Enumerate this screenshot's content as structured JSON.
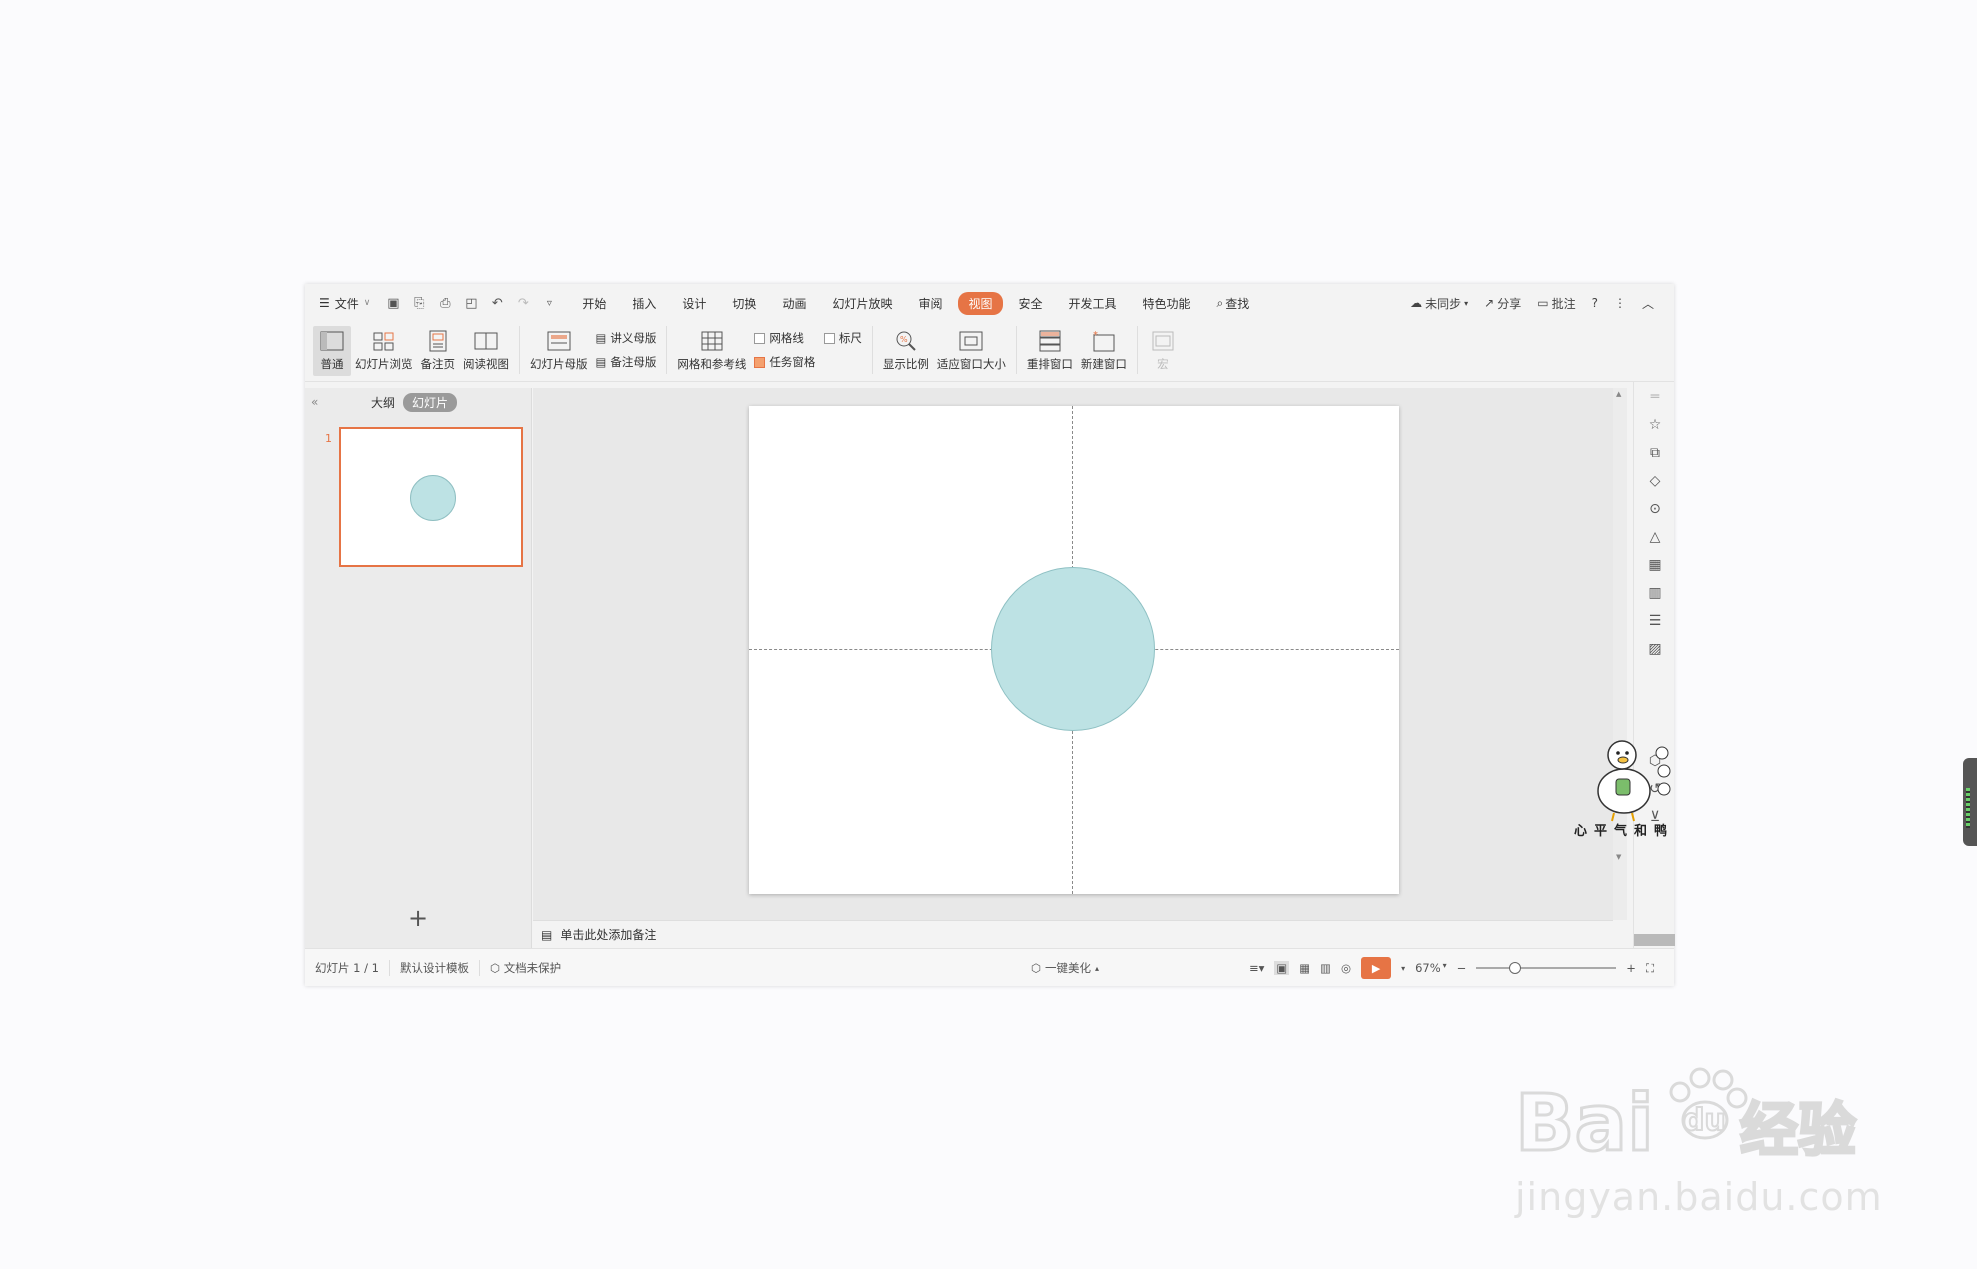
{
  "menubar": {
    "file_label": "文件",
    "tabs": [
      "开始",
      "插入",
      "设计",
      "切换",
      "动画",
      "幻灯片放映",
      "审阅",
      "视图",
      "安全",
      "开发工具",
      "特色功能"
    ],
    "active_tab": "视图",
    "search_label": "查找",
    "sync_label": "未同步",
    "share_label": "分享",
    "comment_label": "批注",
    "help_label": "?"
  },
  "ribbon": {
    "normal": "普通",
    "slide_browse": "幻灯片浏览",
    "notes_page": "备注页",
    "reading_view": "阅读视图",
    "slide_master": "幻灯片母版",
    "handout_master": "讲义母版",
    "notes_master": "备注母版",
    "grid_guides": "网格和参考线",
    "gridlines": "网格线",
    "ruler": "标尺",
    "task_pane": "任务窗格",
    "zoom": "显示比例",
    "fit_window": "适应窗口大小",
    "arrange_window": "重排窗口",
    "new_window": "新建窗口",
    "macro": "宏"
  },
  "leftpanel": {
    "outline_tab": "大纲",
    "slides_tab": "幻灯片",
    "slide_number": "1",
    "add_button": "+"
  },
  "notes": {
    "placeholder": "单击此处添加备注"
  },
  "statusbar": {
    "slide_count": "幻灯片 1 / 1",
    "template": "默认设计模板",
    "protection": "文档未保护",
    "beautify": "一键美化",
    "zoom_level": "67%",
    "zoom_fraction": 0.28
  },
  "mascot": {
    "caption": "心平气和鸭"
  },
  "watermark": {
    "brand": "Baidu经验",
    "url": "jingyan.baidu.com"
  },
  "colors": {
    "accent": "#e67445",
    "shape_fill": "#bde2e4",
    "shape_stroke": "#8ec0c3"
  }
}
